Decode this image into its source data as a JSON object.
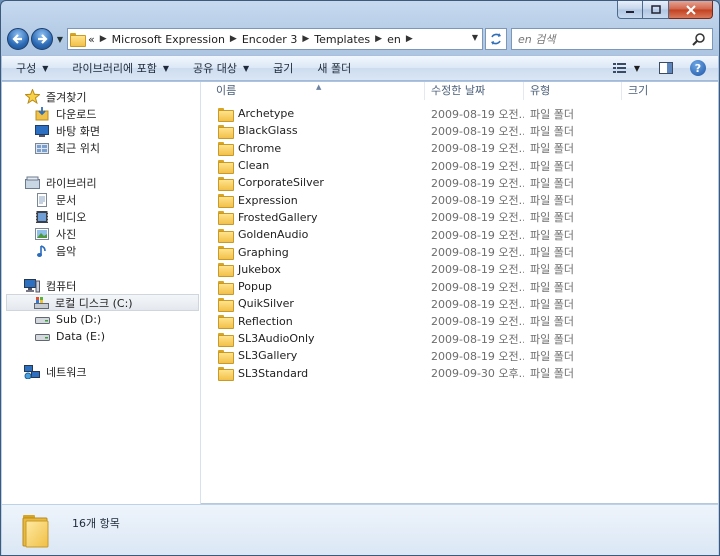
{
  "address": {
    "crumbs": [
      "Microsoft Expression",
      "Encoder 3",
      "Templates",
      "en"
    ],
    "overflow": "«"
  },
  "search": {
    "placeholder": "en 검색"
  },
  "toolbar": {
    "organize": "구성",
    "include_in_library": "라이브러리에 포함",
    "share_with": "공유 대상",
    "burn": "굽기",
    "new_folder": "새 폴더",
    "help": "?"
  },
  "nav": {
    "favorites": {
      "label": "즐겨찾기",
      "items": [
        "다운로드",
        "바탕 화면",
        "최근 위치"
      ]
    },
    "libraries": {
      "label": "라이브러리",
      "items": [
        "문서",
        "비디오",
        "사진",
        "음악"
      ]
    },
    "computer": {
      "label": "컴퓨터",
      "items": [
        "로컬 디스크 (C:)",
        "Sub (D:)",
        "Data (E:)"
      ]
    },
    "network": {
      "label": "네트워크"
    }
  },
  "columns": {
    "name": "이름",
    "date": "수정한 날짜",
    "type": "유형",
    "size": "크기"
  },
  "files": [
    {
      "name": "Archetype",
      "date": "2009-08-19 오전...",
      "type": "파일 폴더"
    },
    {
      "name": "BlackGlass",
      "date": "2009-08-19 오전...",
      "type": "파일 폴더"
    },
    {
      "name": "Chrome",
      "date": "2009-08-19 오전...",
      "type": "파일 폴더"
    },
    {
      "name": "Clean",
      "date": "2009-08-19 오전...",
      "type": "파일 폴더"
    },
    {
      "name": "CorporateSilver",
      "date": "2009-08-19 오전...",
      "type": "파일 폴더"
    },
    {
      "name": "Expression",
      "date": "2009-08-19 오전...",
      "type": "파일 폴더"
    },
    {
      "name": "FrostedGallery",
      "date": "2009-08-19 오전...",
      "type": "파일 폴더"
    },
    {
      "name": "GoldenAudio",
      "date": "2009-08-19 오전...",
      "type": "파일 폴더"
    },
    {
      "name": "Graphing",
      "date": "2009-08-19 오전...",
      "type": "파일 폴더"
    },
    {
      "name": "Jukebox",
      "date": "2009-08-19 오전...",
      "type": "파일 폴더"
    },
    {
      "name": "Popup",
      "date": "2009-08-19 오전...",
      "type": "파일 폴더"
    },
    {
      "name": "QuikSilver",
      "date": "2009-08-19 오전...",
      "type": "파일 폴더"
    },
    {
      "name": "Reflection",
      "date": "2009-08-19 오전...",
      "type": "파일 폴더"
    },
    {
      "name": "SL3AudioOnly",
      "date": "2009-08-19 오전...",
      "type": "파일 폴더"
    },
    {
      "name": "SL3Gallery",
      "date": "2009-08-19 오전...",
      "type": "파일 폴더"
    },
    {
      "name": "SL3Standard",
      "date": "2009-09-30 오후...",
      "type": "파일 폴더"
    }
  ],
  "details": {
    "count": "16개 항목"
  }
}
